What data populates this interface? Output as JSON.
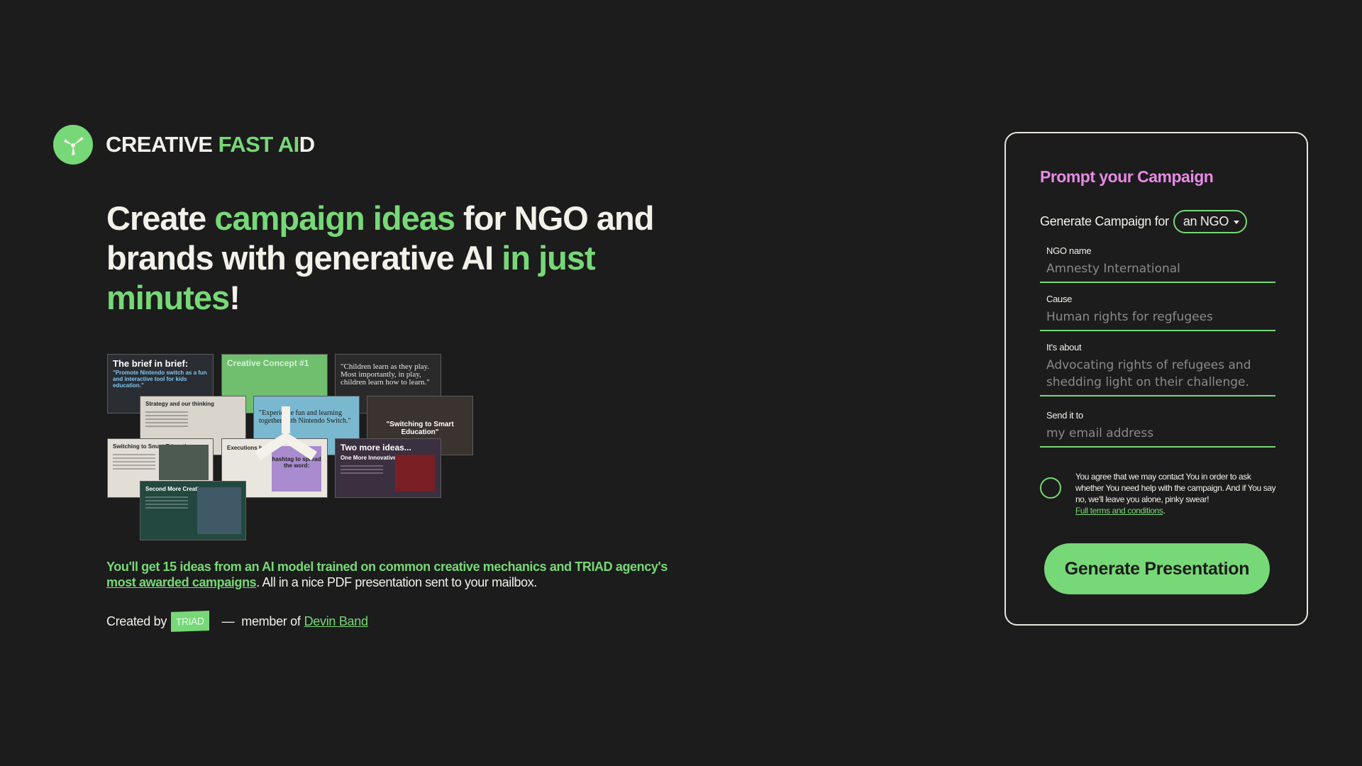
{
  "brand": {
    "name_part1": "CREATIVE ",
    "name_part2": "FAST AI",
    "name_part3": "D",
    "logo_icon": "propeller-icon"
  },
  "headline": {
    "p1": "Create ",
    "p2": "campaign ideas",
    "p3": " for NGO and brands with generative AI ",
    "p4": "in just minutes",
    "p5": "!"
  },
  "collage": {
    "brief_title": "The brief in brief:",
    "brief_quote": "\"Promote Nintendo switch as a fun and interactive tool for kids education.\"",
    "concept_title": "Creative Concept #1",
    "quote_text": "\"Children learn as they play. Most importantly, in play, children learn how to learn.\"",
    "strategy_title": "Strategy and our thinking",
    "blue_quote": "\"Experience fun and learning together with Nintendo Switch.\"",
    "smart_title": "\"Switching to Smart Education\"",
    "switch_title": "Switching to Smart Education",
    "exec_title": "Executions ha...",
    "exec_purple": "hashtag to spread the word:",
    "two_title": "Two more ideas...",
    "two_sub": "One More Innovative",
    "second_title": "Second More Creative"
  },
  "description": {
    "part1": "You'll get 15 ideas from an AI model trained on common creative mechanics and TRIAD agency's ",
    "link": "most awarded campaigns",
    "part2": ". All in a nice PDF presentation sent to your mailbox."
  },
  "credit": {
    "created_by": "Created by",
    "triad": "TRIAD",
    "dash": "—",
    "member_of": "member of",
    "band_link": "Devin Band"
  },
  "form": {
    "title": "Prompt your Campaign",
    "generate_for_label": "Generate Campaign for",
    "generate_for_value": "an NGO",
    "fields": [
      {
        "label": "NGO name",
        "placeholder": "Amnesty International"
      },
      {
        "label": "Cause",
        "placeholder": "Human rights for regfugees"
      },
      {
        "label": "It's about",
        "placeholder": "Advocating rights of refugees and shedding light on their challenge."
      },
      {
        "label": "Send it to",
        "placeholder": "my email address"
      }
    ],
    "consent_text": "You agree that we may contact You in order to ask whether You need help with the campaign. And if You say no, we'll leave you alone, pinky swear!",
    "terms_link": "Full terms and conditions",
    "terms_suffix": ".",
    "submit_label": "Generate Presentation"
  },
  "colors": {
    "background": "#1c1c1c",
    "accent_green": "#77d877",
    "title_pink": "#e88ae6",
    "text": "#f3f1ea"
  }
}
